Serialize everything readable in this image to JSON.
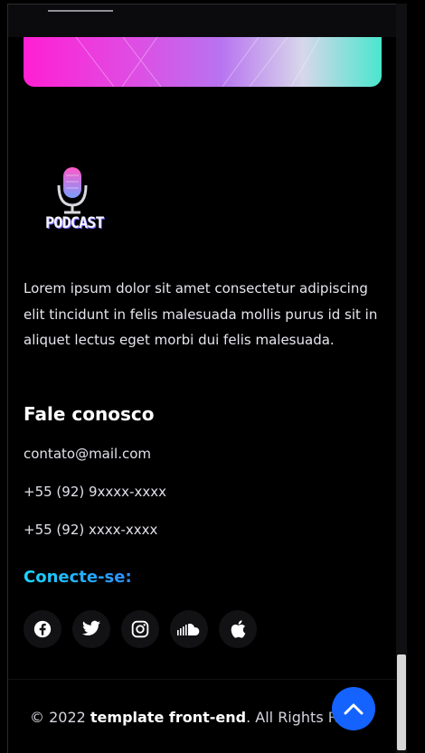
{
  "brand": {
    "logo_text": "PODCAST",
    "logo_icon": "microphone-icon",
    "top_logo_fragment": "template-logo-fragment"
  },
  "about": {
    "description": "Lorem ipsum dolor sit amet consectetur adipiscing elit tincidunt in felis malesuada mollis purus id sit in aliquet lectus eget morbi dui felis malesuada."
  },
  "contact": {
    "heading": "Fale conosco",
    "email": "contato@mail.com",
    "phone_1": "+55 (92) 9xxxx-xxxx",
    "phone_2": "+55 (92) xxxx-xxxx"
  },
  "social": {
    "heading": "Conecte-se:",
    "links": [
      {
        "name": "facebook-icon"
      },
      {
        "name": "twitter-icon"
      },
      {
        "name": "instagram-icon"
      },
      {
        "name": "soundcloud-icon"
      },
      {
        "name": "apple-icon"
      }
    ]
  },
  "footer": {
    "copyright_prefix": "© 2022 ",
    "brand": "template front-end",
    "rights": ". All Rights Res"
  },
  "colors": {
    "background": "#000000",
    "accent": "#1463ff",
    "connect_gradient_start": "#18d7ff",
    "connect_gradient_end": "#2f8dff"
  }
}
